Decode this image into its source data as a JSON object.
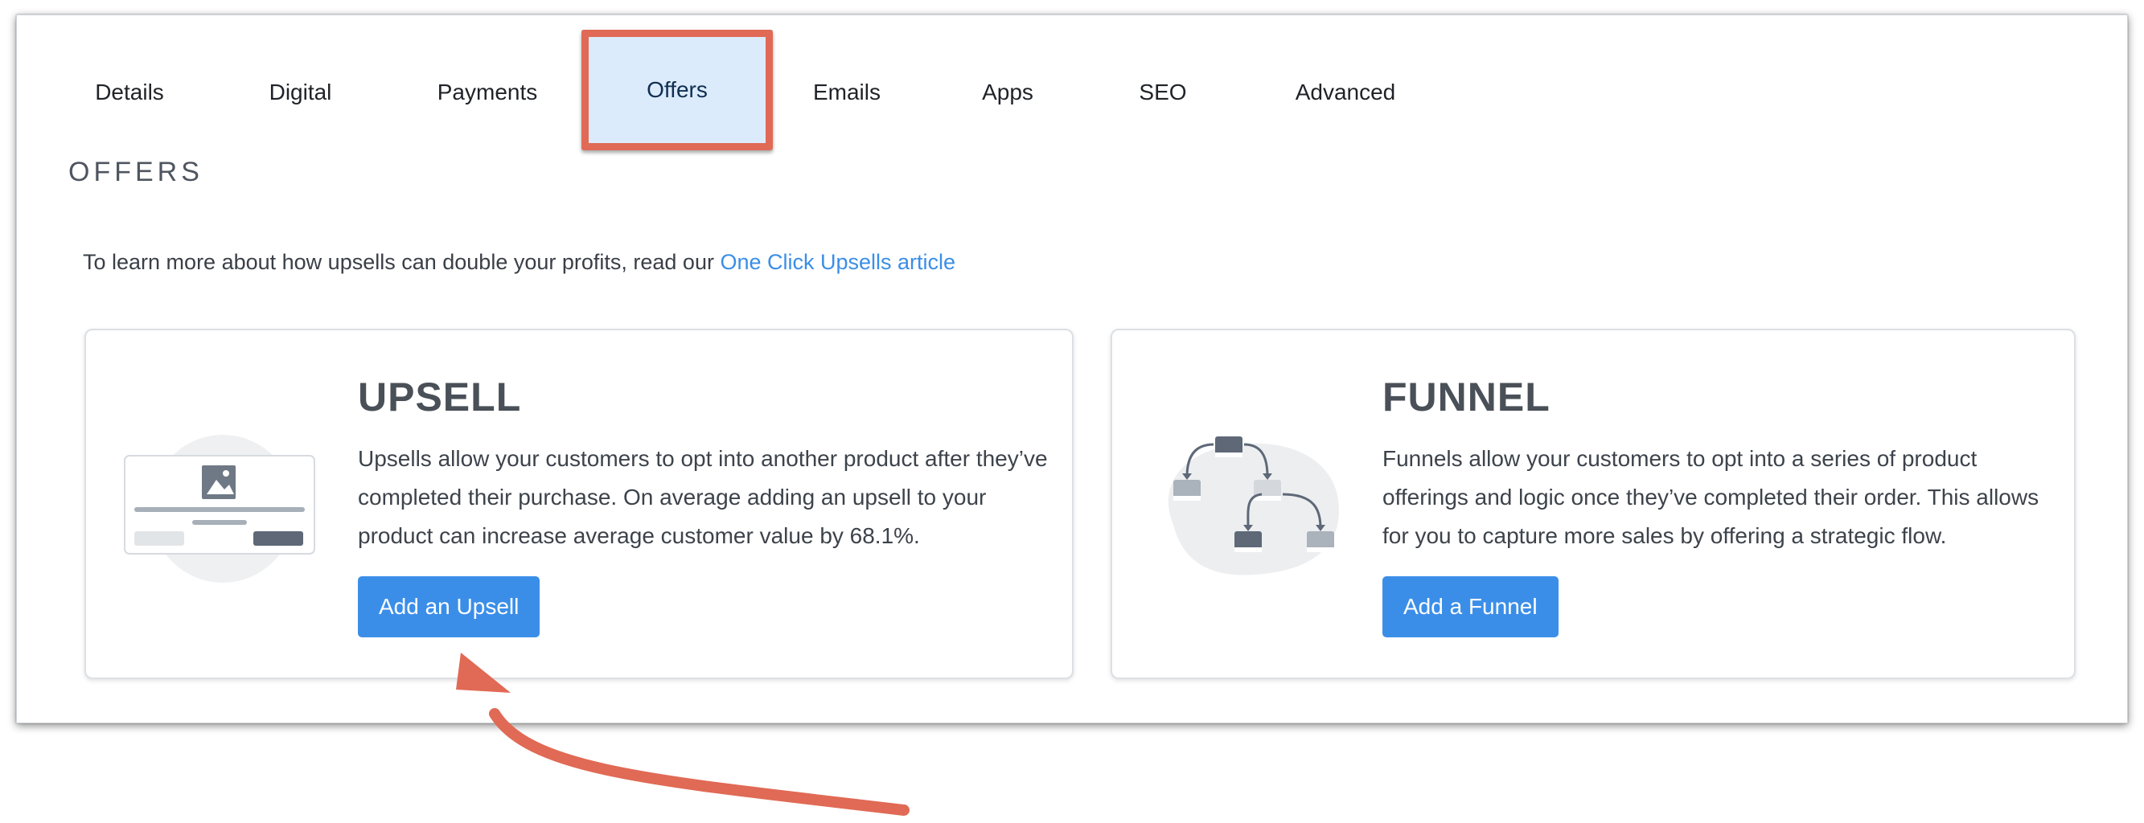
{
  "tabs": [
    {
      "label": "Details"
    },
    {
      "label": "Digital"
    },
    {
      "label": "Payments"
    },
    {
      "label": "Offers"
    },
    {
      "label": "Emails"
    },
    {
      "label": "Apps"
    },
    {
      "label": "SEO"
    },
    {
      "label": "Advanced"
    }
  ],
  "active_tab": "Offers",
  "section": {
    "title": "OFFERS",
    "intro_text": "To learn more about how upsells can double your profits, read our ",
    "intro_link": "One Click Upsells article"
  },
  "cards": {
    "upsell": {
      "title": "UPSELL",
      "description": "Upsells allow your customers to opt into another product after they’ve completed their purchase. On average adding an upsell to your product can increase average customer value by 68.1%.",
      "button": "Add an Upsell",
      "icon": "product-card-illustration"
    },
    "funnel": {
      "title": "FUNNEL",
      "description": "Funnels allow your customers to opt into a series of product offerings and logic once they’ve completed their order. This allows for you to capture more sales by offering a strategic flow.",
      "button": "Add a Funnel",
      "icon": "flow-diagram-illustration"
    }
  },
  "colors": {
    "accent": "#3b8ee8",
    "highlight": "#e06a55",
    "active_tab_bg": "#dcebfb"
  }
}
